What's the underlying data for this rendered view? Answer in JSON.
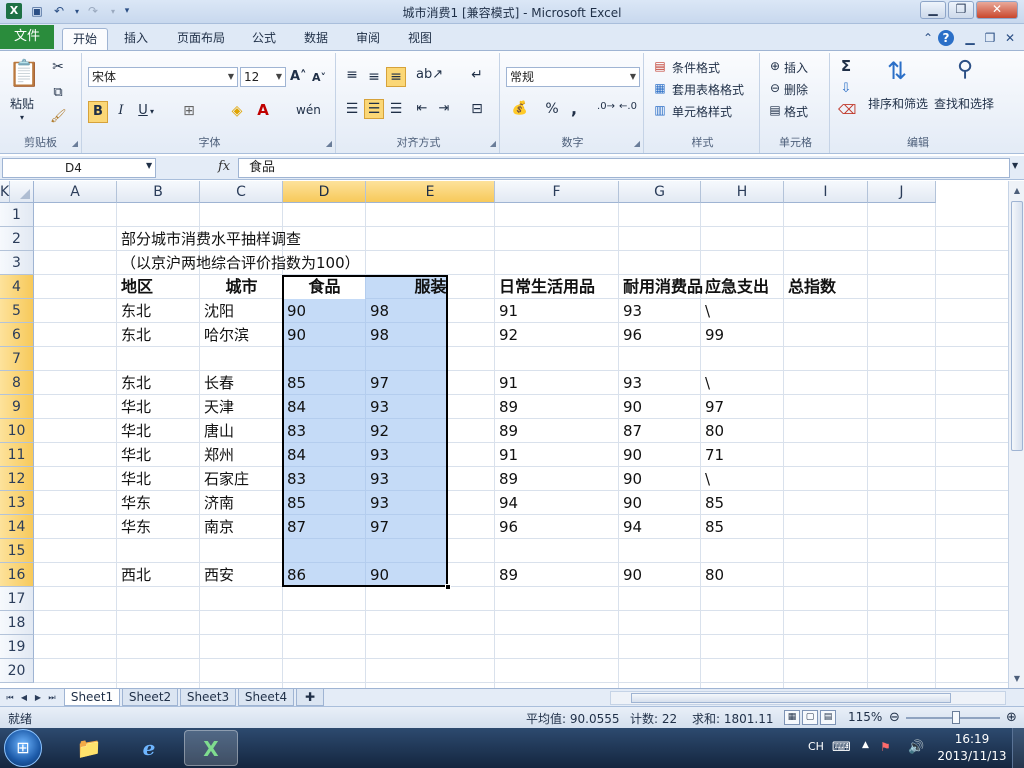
{
  "window": {
    "title": "城市消费1  [兼容模式]  -  Microsoft Excel",
    "file_tab": "文件",
    "tabs": [
      "开始",
      "插入",
      "页面布局",
      "公式",
      "数据",
      "审阅",
      "视图"
    ]
  },
  "ribbon": {
    "clipboard": {
      "label": "剪贴板",
      "paste": "粘贴"
    },
    "font": {
      "label": "字体",
      "name": "宋体",
      "size": "12",
      "bold": "B",
      "italic": "I",
      "underline": "U"
    },
    "alignment": {
      "label": "对齐方式"
    },
    "number": {
      "label": "数字",
      "format": "常规",
      "percent": "%",
      "comma": ","
    },
    "styles": {
      "label": "样式",
      "conditional": "条件格式",
      "table": "套用表格格式",
      "cell": "单元格样式"
    },
    "cells": {
      "label": "单元格",
      "insert": "插入",
      "delete": "删除",
      "format": "格式"
    },
    "editing": {
      "label": "编辑",
      "sort_filter": "排序和筛选",
      "find_select": "查找和选择"
    }
  },
  "formula_bar": {
    "name_box": "D4",
    "fx": "fx",
    "content": "食品"
  },
  "grid": {
    "columns": [
      "A",
      "B",
      "C",
      "D",
      "E",
      "F",
      "G",
      "H",
      "I",
      "J",
      "K"
    ],
    "rows": [
      "1",
      "2",
      "3",
      "4",
      "5",
      "6",
      "7",
      "8",
      "9",
      "10",
      "11",
      "12",
      "13",
      "14",
      "15",
      "16",
      "17",
      "18",
      "19",
      "20"
    ],
    "title": "部分城市消费水平抽样调查",
    "subtitle": "（以京沪两地综合评价指数为100）",
    "headers": [
      "地区",
      "城市",
      "食品",
      "服装",
      "日常生活用品",
      "耐用消费品",
      "应急支出",
      "总指数"
    ],
    "data_rows": [
      {
        "row": 5,
        "region": "东北",
        "city": "沈阳",
        "food": "90",
        "clothing": "98",
        "daily": "91",
        "durable": "93",
        "emergency": "\\"
      },
      {
        "row": 6,
        "region": "东北",
        "city": "哈尔滨",
        "food": "90",
        "clothing": "98",
        "daily": "92",
        "durable": "96",
        "emergency": "99"
      },
      {
        "row": 8,
        "region": "东北",
        "city": "长春",
        "food": "85",
        "clothing": "97",
        "daily": "91",
        "durable": "93",
        "emergency": "\\"
      },
      {
        "row": 9,
        "region": "华北",
        "city": "天津",
        "food": "84",
        "clothing": "93",
        "daily": "89",
        "durable": "90",
        "emergency": "97"
      },
      {
        "row": 10,
        "region": "华北",
        "city": "唐山",
        "food": "83",
        "clothing": "92",
        "daily": "89",
        "durable": "87",
        "emergency": "80"
      },
      {
        "row": 11,
        "region": "华北",
        "city": "郑州",
        "food": "84",
        "clothing": "93",
        "daily": "91",
        "durable": "90",
        "emergency": "71"
      },
      {
        "row": 12,
        "region": "华北",
        "city": "石家庄",
        "food": "83",
        "clothing": "93",
        "daily": "89",
        "durable": "90",
        "emergency": "\\"
      },
      {
        "row": 13,
        "region": "华东",
        "city": "济南",
        "food": "85",
        "clothing": "93",
        "daily": "94",
        "durable": "90",
        "emergency": "85"
      },
      {
        "row": 14,
        "region": "华东",
        "city": "南京",
        "food": "87",
        "clothing": "97",
        "daily": "96",
        "durable": "94",
        "emergency": "85"
      },
      {
        "row": 16,
        "region": "西北",
        "city": "西安",
        "food": "86",
        "clothing": "90",
        "daily": "89",
        "durable": "90",
        "emergency": "80"
      }
    ]
  },
  "sheets": [
    "Sheet1",
    "Sheet2",
    "Sheet3",
    "Sheet4"
  ],
  "status": {
    "ready": "就绪",
    "average": "平均值: 90.0555",
    "count": "计数: 22",
    "sum": "求和: 1801.11",
    "zoom": "115%"
  },
  "taskbar": {
    "ime": "CH",
    "time": "16:19",
    "date": "2013/11/13"
  },
  "colors": {
    "file_tab": "#2a8c3c",
    "selection": "#96bef0",
    "header_selected": "#f7c95a"
  }
}
